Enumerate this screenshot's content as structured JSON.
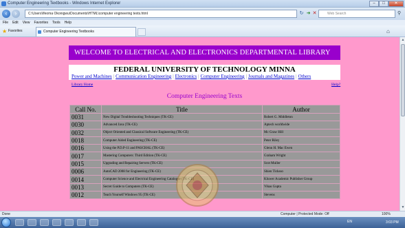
{
  "window": {
    "title": "Computer Engineering Textbooks - Windows Internet Explorer",
    "buttons": {
      "minimize": "–",
      "maximize": "□",
      "close": "✕"
    }
  },
  "address_bar": {
    "url": "C:\\Users\\Ifeoma Okonigwu\\Documents\\HTML\\computer engineering texts.html",
    "search_placeholder": "Web Search"
  },
  "menu": [
    "File",
    "Edit",
    "View",
    "Favorites",
    "Tools",
    "Help"
  ],
  "favorites_bar": {
    "favorites_label": "Favorites",
    "tab_title": "Computer Engineering Textbooks"
  },
  "page": {
    "banner": "WELCOME TO ELECTRICAL AND ELECTRONICS DEPARTMENTAL LIBRARY",
    "university": "FEDERAL UNIVERSITY OF TECHNOLOGY MINNA",
    "nav_links": [
      "Power and Machines",
      "Communication Engineering",
      "Electronics",
      "Computer Engineering",
      "Journals and Magazines",
      "Others"
    ],
    "library_home": "Library Home",
    "help": "Help?",
    "section_title": "Computer Engineering Texts",
    "table": {
      "headers": [
        "Call No.",
        "Title",
        "Author"
      ],
      "rows": [
        [
          "0031",
          "New Digital Troubleshooting Techniques (TK-CE)",
          "Robert G. Middleton"
        ],
        [
          "0030",
          "Advanced Java (TK-CE)",
          "Aptech worldwide"
        ],
        [
          "0032",
          "Object Oriented and Classical Software Engineering (TK-CE)",
          "Mc Graw Hill"
        ],
        [
          "0018",
          "Computer Aided Engineering (TK-CE)",
          "Peter Riley"
        ],
        [
          "0016",
          "Using the P.D.P-11 and PASCHAL (TK-CE)",
          "Glenn H. Mac Ewen"
        ],
        [
          "0017",
          "Mastering Computers: Third Edition (TK-CE)",
          "Graham Wright"
        ],
        [
          "0015",
          "Upgrading and Repairing Servers (TK-CE)",
          "Scot Muller"
        ],
        [
          "0006",
          "AutoCAD 2008 for Engineering (TK-CE)",
          "Shien Ticksso"
        ],
        [
          "0014",
          "Computer Science and Electrical Engineering Catalogue (TK-CE)",
          "Kluwer Academic Publisher Group"
        ],
        [
          "0013",
          "Secret Guide to Computers (TK-CE)",
          "Vikas Gupta"
        ],
        [
          "0012",
          "Teach Yourself Windows 95 (TK-CE)",
          "Stevens"
        ]
      ]
    }
  },
  "status_bar": {
    "left": "Done",
    "zone": "Computer | Protected Mode: Off",
    "zoom": "100%"
  },
  "taskbar": {
    "clock": "3:03 PM",
    "tray_text": "EN"
  }
}
